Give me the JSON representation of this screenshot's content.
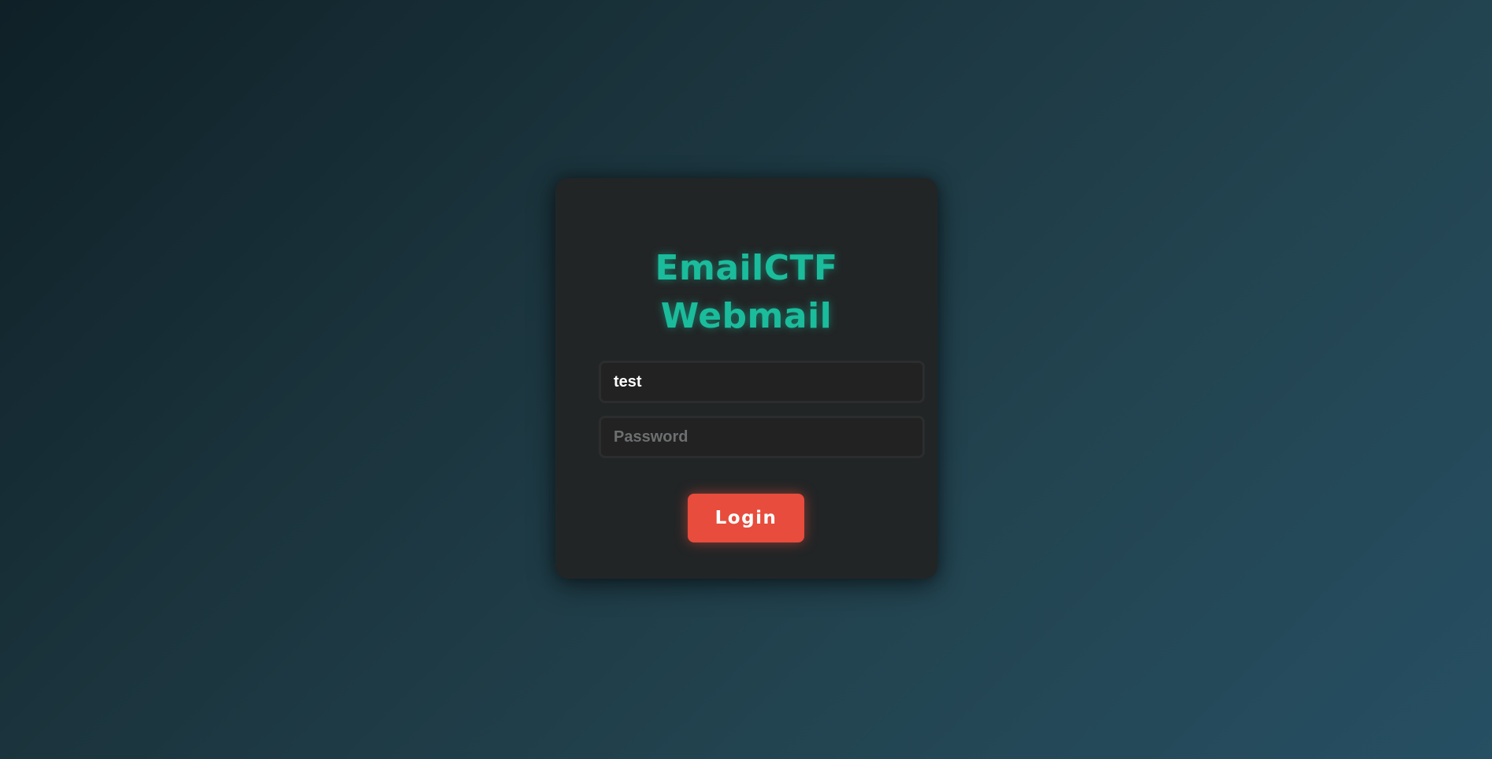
{
  "app": {
    "title_line1": "EmailCTF",
    "title_line2": "Webmail"
  },
  "login_form": {
    "username_value": "test",
    "password_placeholder": "Password",
    "login_label": "Login"
  },
  "colors": {
    "accent": "#1abc9c",
    "button": "#e74c3c",
    "card_background": "#222526"
  }
}
